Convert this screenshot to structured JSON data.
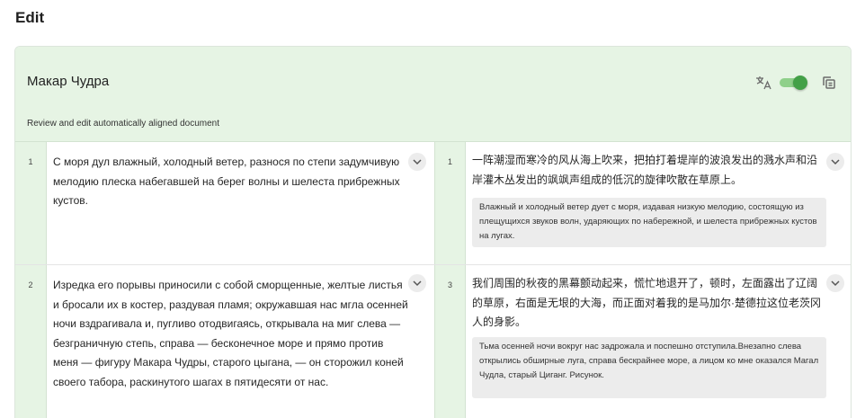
{
  "page": {
    "title": "Edit"
  },
  "document": {
    "title": "Макар Чудра",
    "subtitle": "Review and edit automatically aligned document"
  },
  "toolbar": {
    "translate_icon": "translate-icon",
    "toggle_state": "on",
    "copy_icon": "copy-icon",
    "accent_color": "#43a047"
  },
  "rows": [
    {
      "source_num": "1",
      "source_text": "С моря дул влажный, холодный ветер, разнося по степи задумчивую мелодию плеска набегавшей на берег волны и шелеста прибрежных кустов.",
      "target_num": "1",
      "target_text": "一阵潮湿而寒冷的风从海上吹来，把拍打着堤岸的波浪发出的溅水声和沿岸灌木丛发出的飒飒声组成的低沉的旋律吹散在草原上。",
      "back_translation": "Влажный и холодный ветер дует с моря, издавая низкую мелодию, состоящую из плещущихся звуков волн, ударяющих по набережной, и шелеста прибрежных кустов на лугах."
    },
    {
      "source_num": "2",
      "source_text": "Изредка его порывы приносили с собой сморщенные, желтые листья и бросали их в костер, раздувая пламя; окружавшая нас мгла осенней ночи вздрагивала и, пугливо отодвигаясь, открывала на миг слева — безграничную степь, справа — бесконечное море и прямо против меня — фигуру Макара Чудры, старого цыгана, — он сторожил коней своего табора, раскинутого шагах в пятидесяти от нас.",
      "target_num": "3",
      "target_text": "我们周围的秋夜的黑幕颤动起来，慌忙地退开了，顿时，左面露出了辽阔的草原，右面是无垠的大海，而正面对着我的是马加尔·楚德拉这位老茨冈人的身影。",
      "back_translation": "Тьма осенней ночи вокруг нас задрожала и поспешно отступила.Внезапно слева открылись обширные луга, справа бескрайнее море, а лицом ко мне оказался Магал Чудла, старый Циганг. Рисунок."
    }
  ]
}
